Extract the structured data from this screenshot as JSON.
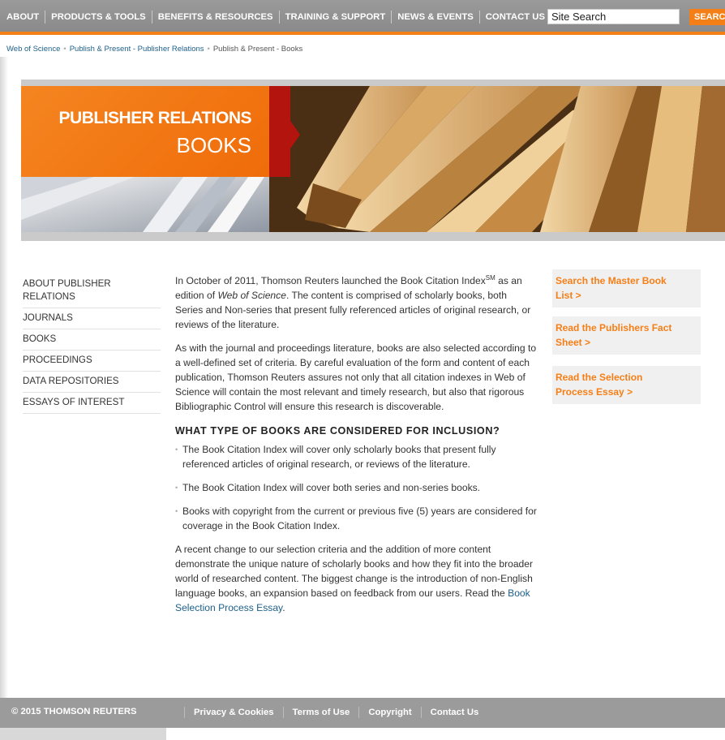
{
  "topnav": {
    "items": [
      "ABOUT",
      "PRODUCTS & TOOLS",
      "BENEFITS & RESOURCES",
      "TRAINING & SUPPORT",
      "NEWS & EVENTS",
      "CONTACT US"
    ],
    "search_value": "Site Search",
    "search_button": "SEARCH",
    "accent": "#f57f17"
  },
  "breadcrumb": {
    "items": [
      "Web of Science",
      "Publish & Present - Publisher Relations",
      "Publish & Present - Books"
    ]
  },
  "banner": {
    "title": "PUBLISHER RELATIONS",
    "subtitle": "BOOKS"
  },
  "leftnav": {
    "items": [
      "ABOUT PUBLISHER RELATIONS",
      "JOURNALS",
      "BOOKS",
      "PROCEEDINGS",
      "DATA REPOSITORIES",
      "ESSAYS OF INTEREST"
    ]
  },
  "main": {
    "p1_a": "In October of 2011, Thomson Reuters launched the Book Citation Index",
    "p1_sup": "SM",
    "p1_b": " as an edition of ",
    "p1_em": "Web of Science",
    "p1_c": ". The content is comprised of scholarly books, both Series and Non-series that present fully referenced articles of original research, or reviews of the literature.",
    "p2": "As with the journal and proceedings literature, books are also selected according to a well-defined set of criteria. By careful evaluation of the form and content of each publication, Thomson Reuters assures not only that all citation indexes in Web of Science will contain the most relevant and timely research, but also that rigorous Bibliographic Control will ensure this research is discoverable.",
    "heading": "WHAT TYPE OF BOOKS ARE CONSIDERED FOR INCLUSION?",
    "bullets": [
      "The Book Citation Index will cover only scholarly books that present fully referenced articles of original research, or reviews of the literature.",
      "The Book Citation Index will cover both series and non-series books.",
      "Books with copyright from the current or previous five (5) years are considered for coverage in the Book Citation Index."
    ],
    "p3": "A recent change to our selection criteria and the addition of more content demonstrate the unique nature of scholarly books and how they fit into the broader world of researched content. The biggest change is the introduction of non-English language books, an expansion based on feedback from our users. Read the ",
    "p3_link": "Book Selection Process Essay",
    "p3_end": "."
  },
  "sidebar_links": [
    "Search the Master Book List >",
    "Read the Publishers Fact Sheet >",
    "Read the Selection Process Essay >"
  ],
  "footer": {
    "copyright": "© 2015 THOMSON REUTERS",
    "links": [
      "Privacy & Cookies",
      "Terms of Use",
      "Copyright",
      "Contact Us"
    ]
  }
}
